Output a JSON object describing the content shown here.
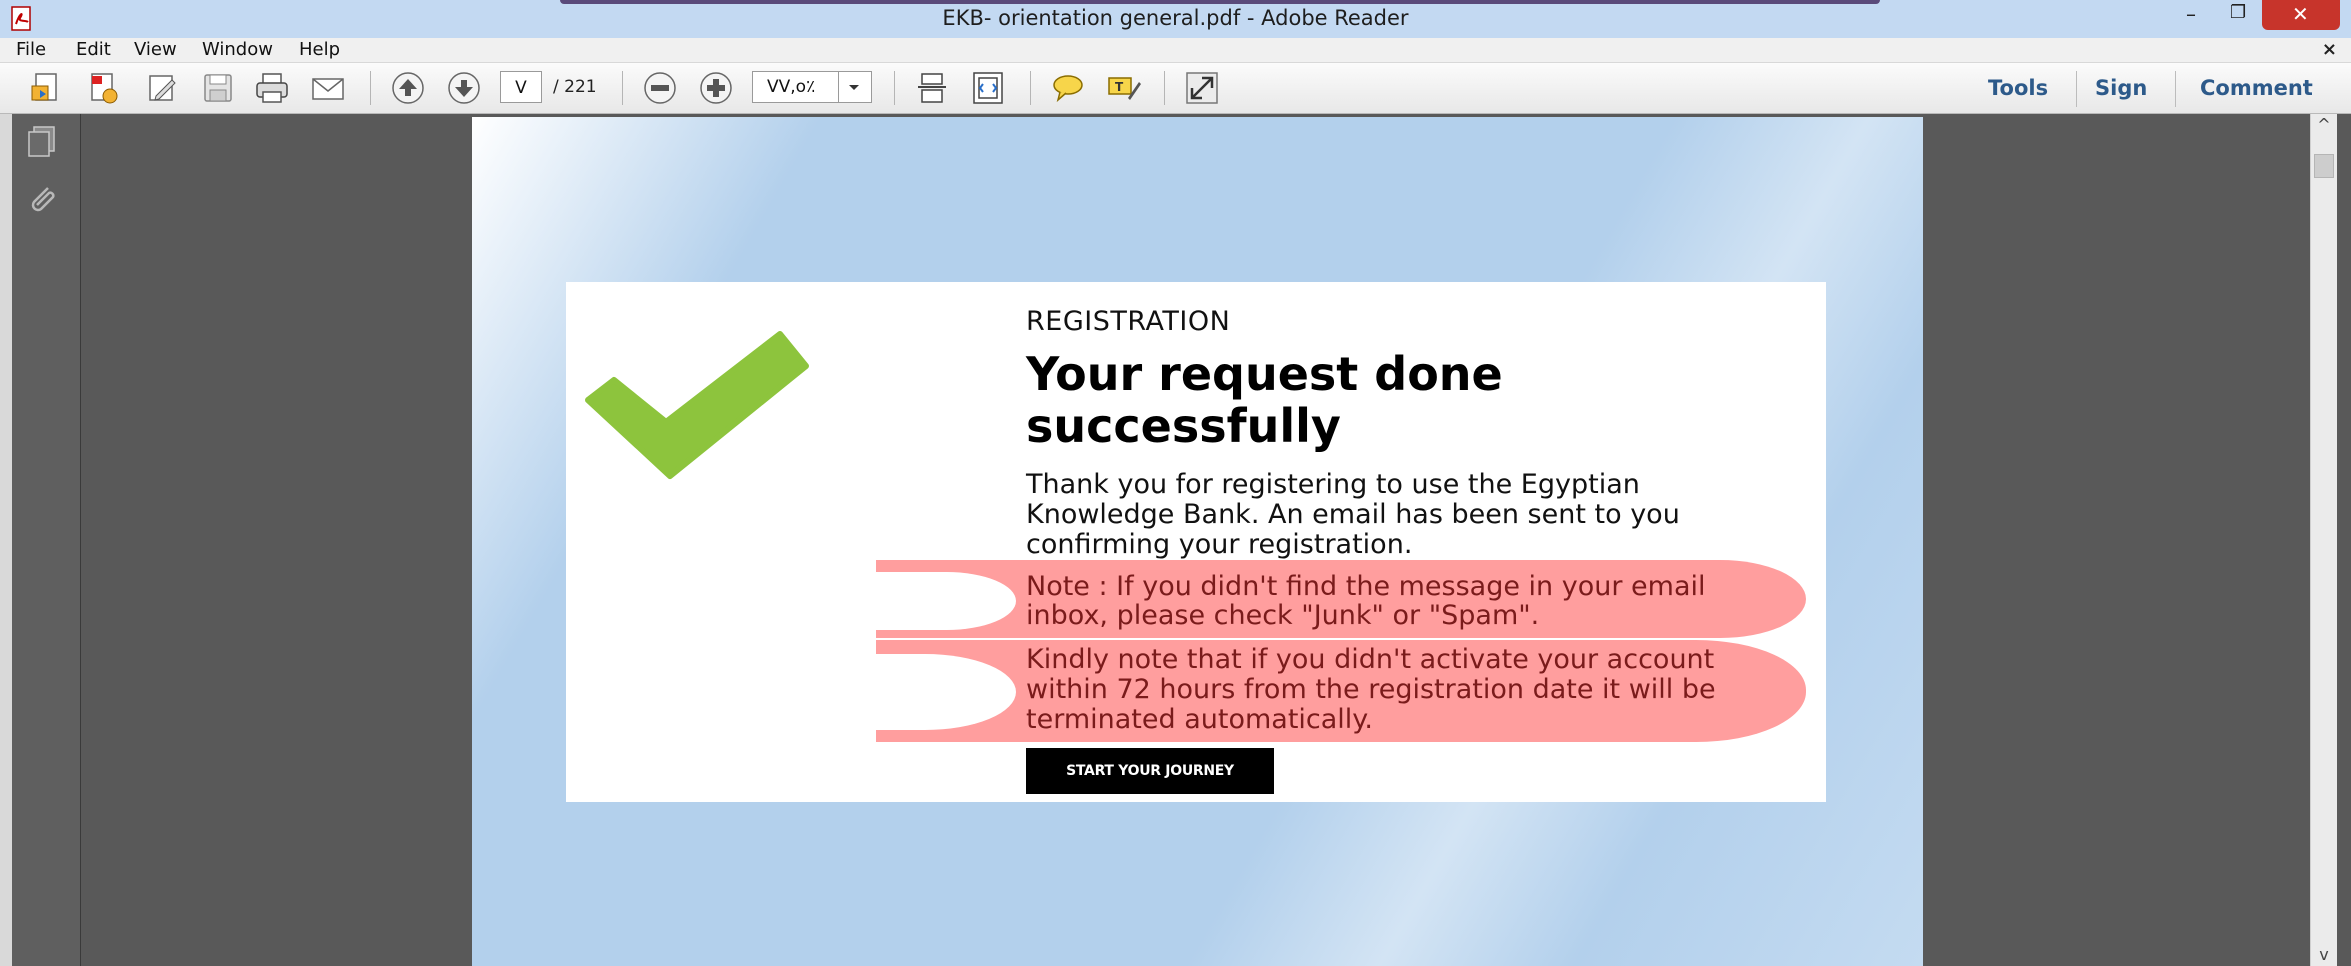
{
  "window": {
    "title": "EKB- orientation general.pdf - Adobe Reader",
    "minimize_label": "–",
    "restore_label": "❐",
    "close_label": "✕"
  },
  "menu": {
    "items": [
      "File",
      "Edit",
      "View",
      "Window",
      "Help"
    ],
    "close_doc_label": "×"
  },
  "toolbar": {
    "page_current": "V",
    "page_total": "/ 221",
    "zoom": "VV,o٪",
    "tools_label": "Tools",
    "sign_label": "Sign",
    "comment_label": "Comment"
  },
  "document": {
    "section_label": "REGISTRATION",
    "headline": "Your request done successfully",
    "thanks_text": "Thank you for registering to use the Egyptian Knowledge Bank. An email has been sent to you confirming your registration.",
    "note_spam": "Note : If you didn't find the message in your email inbox, please check \"Junk\" or \"Spam\".",
    "note_activation": "Kindly note that if you didn't activate your account within 72 hours from the registration date it will be terminated automatically.",
    "cta_label": "START YOUR JOURNEY"
  },
  "colors": {
    "highlight": "#ff9e9e",
    "check_green": "#8dc43d",
    "link_blue": "#2d5a8a",
    "close_red": "#c7342b"
  },
  "scroll": {
    "up_label": "^",
    "down_label": "v"
  }
}
